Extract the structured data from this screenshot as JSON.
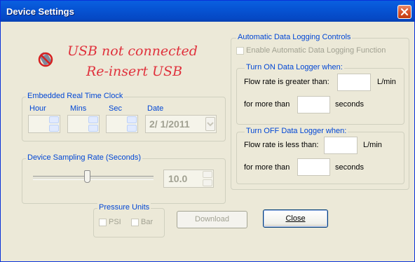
{
  "window": {
    "title": "Device Settings"
  },
  "status": {
    "line1": "USB not connected",
    "line2": "Re-insert USB"
  },
  "clock": {
    "group_label": "Embedded Real Time Clock",
    "hour_label": "Hour",
    "mins_label": "Mins",
    "sec_label": "Sec",
    "date_label": "Date",
    "date_value": "2/  1/2011"
  },
  "sampling": {
    "group_label": "Device Sampling Rate (Seconds)",
    "value": "10.0",
    "slider_level": 0.45
  },
  "pressure": {
    "group_label": "Pressure Units",
    "psi_label": "PSI",
    "bar_label": "Bar"
  },
  "buttons": {
    "download": "Download",
    "close": "Close"
  },
  "logging": {
    "group_label": "Automatic Data Logging Controls",
    "enable_label": "Enable Automatic Data Logging Function",
    "on_group": {
      "label": "Turn ON Data Logger when:",
      "flow_label": "Flow rate is greater than:",
      "flow_unit": "L/min",
      "time_prefix": "for more than",
      "time_unit": "seconds"
    },
    "off_group": {
      "label": "Turn OFF Data Logger when:",
      "flow_label": "Flow rate is less than:",
      "flow_unit": "L/min",
      "time_prefix": "for more than",
      "time_unit": "seconds"
    }
  },
  "colors": {
    "title_bar": "#0654d4",
    "status_text": "#e0313c",
    "group_label": "#0046d5",
    "dialog_bg": "#ece9d8"
  },
  "icons": [
    "close-icon",
    "usb-disconnected-icon",
    "spin-up-icon",
    "spin-down-icon",
    "dropdown-arrow-icon"
  ]
}
